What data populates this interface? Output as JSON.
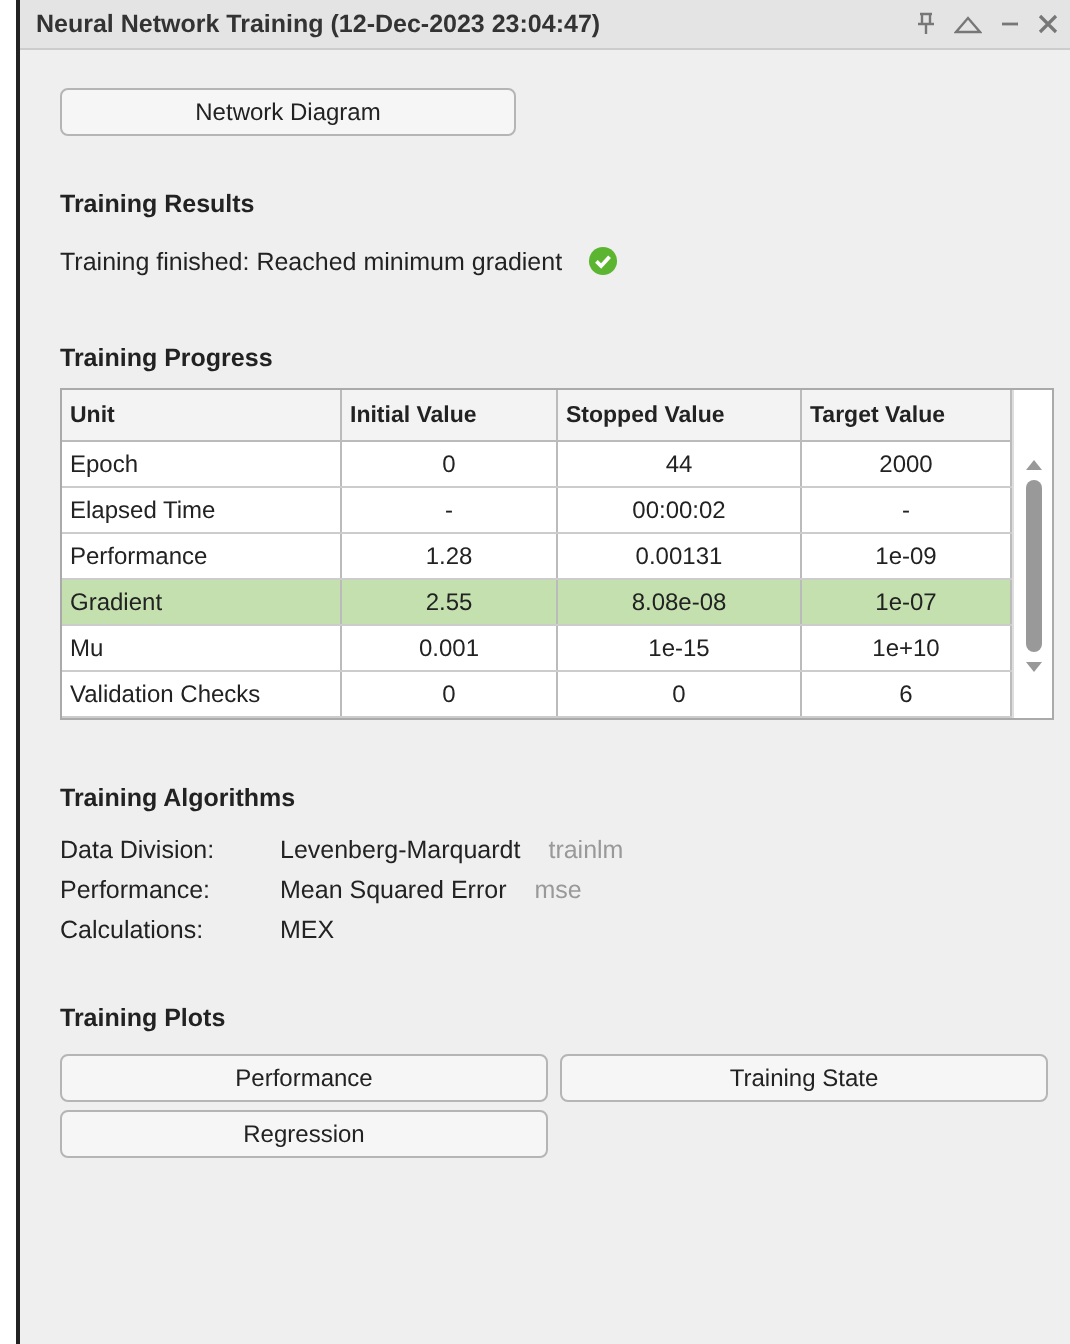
{
  "window": {
    "title": "Neural Network Training (12-Dec-2023 23:04:47)"
  },
  "network_button": "Network Diagram",
  "results": {
    "heading": "Training Results",
    "message": "Training finished: Reached minimum gradient"
  },
  "progress": {
    "heading": "Training Progress",
    "columns": [
      "Unit",
      "Initial Value",
      "Stopped Value",
      "Target Value"
    ],
    "rows": [
      {
        "cells": [
          "Epoch",
          "0",
          "44",
          "2000"
        ],
        "highlighted": false
      },
      {
        "cells": [
          "Elapsed Time",
          "-",
          "00:00:02",
          "-"
        ],
        "highlighted": false
      },
      {
        "cells": [
          "Performance",
          "1.28",
          "0.00131",
          "1e-09"
        ],
        "highlighted": false
      },
      {
        "cells": [
          "Gradient",
          "2.55",
          "8.08e-08",
          "1e-07"
        ],
        "highlighted": true
      },
      {
        "cells": [
          "Mu",
          "0.001",
          "1e-15",
          "1e+10"
        ],
        "highlighted": false
      },
      {
        "cells": [
          "Validation Checks",
          "0",
          "0",
          "6"
        ],
        "highlighted": false
      }
    ]
  },
  "algorithms": {
    "heading": "Training Algorithms",
    "rows": [
      {
        "label": "Data Division:",
        "value": "Levenberg-Marquardt",
        "code": "trainlm"
      },
      {
        "label": "Performance:",
        "value": "Mean Squared Error",
        "code": "mse"
      },
      {
        "label": "Calculations:",
        "value": "MEX"
      }
    ]
  },
  "plots": {
    "heading": "Training Plots",
    "buttons": [
      "Performance",
      "Training State",
      "Regression"
    ]
  }
}
